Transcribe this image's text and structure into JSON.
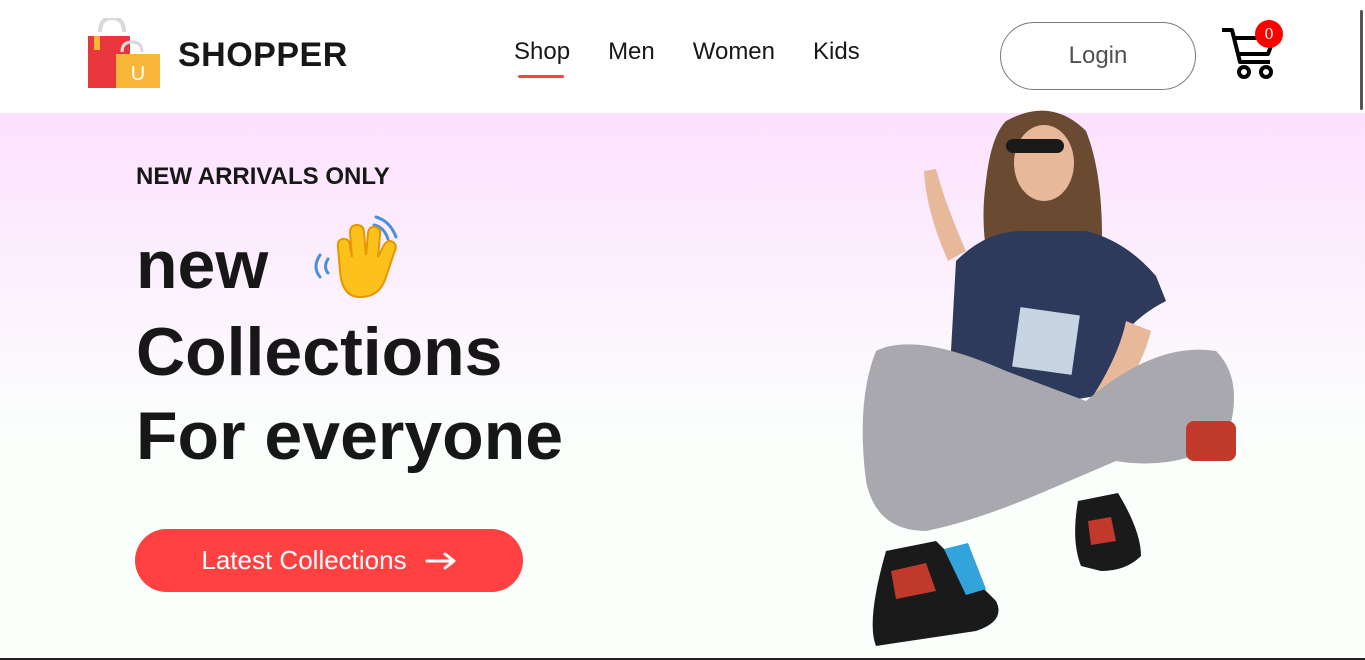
{
  "brand": {
    "name": "SHOPPER",
    "logo_letter": "U"
  },
  "nav": {
    "items": [
      {
        "label": "Shop",
        "active": true
      },
      {
        "label": "Men",
        "active": false
      },
      {
        "label": "Women",
        "active": false
      },
      {
        "label": "Kids",
        "active": false
      }
    ]
  },
  "header": {
    "login_label": "Login",
    "cart_count": "0"
  },
  "hero": {
    "tag": "NEW ARRIVALS ONLY",
    "line1": "new",
    "line2": "Collections",
    "line3": "For everyone",
    "button_label": "Latest Collections"
  },
  "colors": {
    "accent": "#ff4141",
    "badge": "#ff0000",
    "hero_top": "#fde1ff"
  },
  "icons": [
    "shopping-bag-logo-icon",
    "cart-icon",
    "waving-hand-icon",
    "arrow-right-icon"
  ]
}
